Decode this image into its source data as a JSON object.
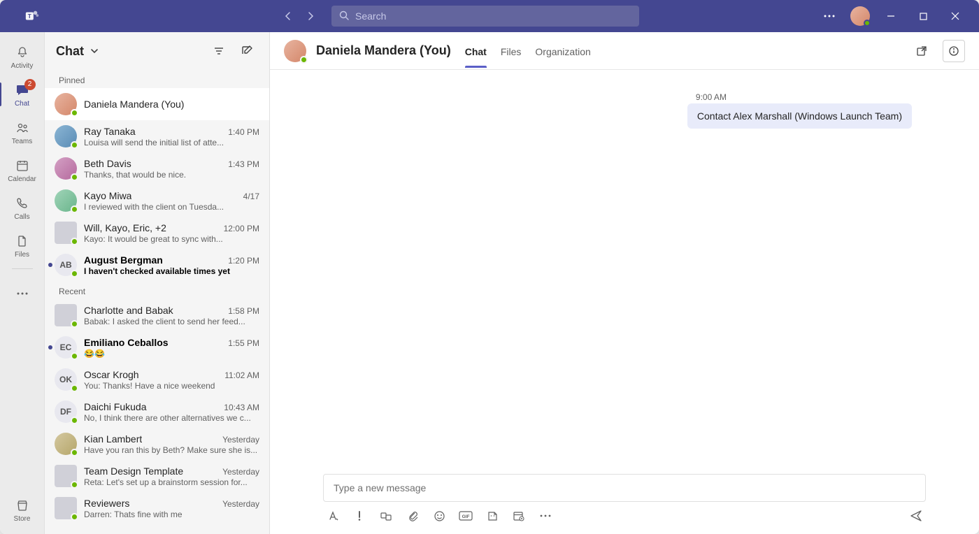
{
  "titlebar": {
    "search_placeholder": "Search"
  },
  "rail": {
    "activity": "Activity",
    "chat": "Chat",
    "chat_badge": "2",
    "teams": "Teams",
    "calendar": "Calendar",
    "calls": "Calls",
    "files": "Files",
    "store": "Store"
  },
  "chatlist": {
    "title": "Chat",
    "pinned_label": "Pinned",
    "recent_label": "Recent",
    "pinned": [
      {
        "name": "Daniela Mandera (You)",
        "time": "",
        "preview": "",
        "initials": "",
        "selected": true,
        "unread": false,
        "avatar": "photo1"
      },
      {
        "name": "Ray Tanaka",
        "time": "1:40 PM",
        "preview": "Louisa will send the initial list of atte...",
        "avatar": "photo2"
      },
      {
        "name": "Beth Davis",
        "time": "1:43 PM",
        "preview": "Thanks, that would be nice.",
        "avatar": "photo3"
      },
      {
        "name": "Kayo Miwa",
        "time": "4/17",
        "preview": "I reviewed with the client on Tuesda...",
        "avatar": "photo4"
      },
      {
        "name": "Will, Kayo, Eric, +2",
        "time": "12:00 PM",
        "preview": "Kayo: It would be great to sync with...",
        "avatar": "group"
      },
      {
        "name": "August Bergman",
        "time": "1:20 PM",
        "preview": "I haven't checked available times yet",
        "initials": "AB",
        "avatar": "initials",
        "unread": true
      }
    ],
    "recent": [
      {
        "name": "Charlotte and Babak",
        "time": "1:58 PM",
        "preview": "Babak: I asked the client to send her feed...",
        "avatar": "group"
      },
      {
        "name": "Emiliano Ceballos",
        "time": "1:55 PM",
        "preview": "😂😂",
        "initials": "EC",
        "avatar": "initials",
        "unread": true
      },
      {
        "name": "Oscar Krogh",
        "time": "11:02 AM",
        "preview": "You: Thanks! Have a nice weekend",
        "initials": "OK",
        "avatar": "initials"
      },
      {
        "name": "Daichi Fukuda",
        "time": "10:43 AM",
        "preview": "No, I think there are other alternatives we c...",
        "initials": "DF",
        "avatar": "initials"
      },
      {
        "name": "Kian Lambert",
        "time": "Yesterday",
        "preview": "Have you ran this by Beth? Make sure she is...",
        "avatar": "photo5"
      },
      {
        "name": "Team Design Template",
        "time": "Yesterday",
        "preview": "Reta: Let's set up a brainstorm session for...",
        "avatar": "group"
      },
      {
        "name": "Reviewers",
        "time": "Yesterday",
        "preview": "Darren: Thats fine with me",
        "avatar": "group"
      }
    ]
  },
  "header": {
    "name": "Daniela Mandera (You)",
    "tabs": {
      "chat": "Chat",
      "files": "Files",
      "org": "Organization"
    }
  },
  "messages": [
    {
      "time": "9:00 AM",
      "text": "Contact Alex Marshall (Windows Launch Team)"
    }
  ],
  "composer": {
    "placeholder": "Type a new message"
  }
}
